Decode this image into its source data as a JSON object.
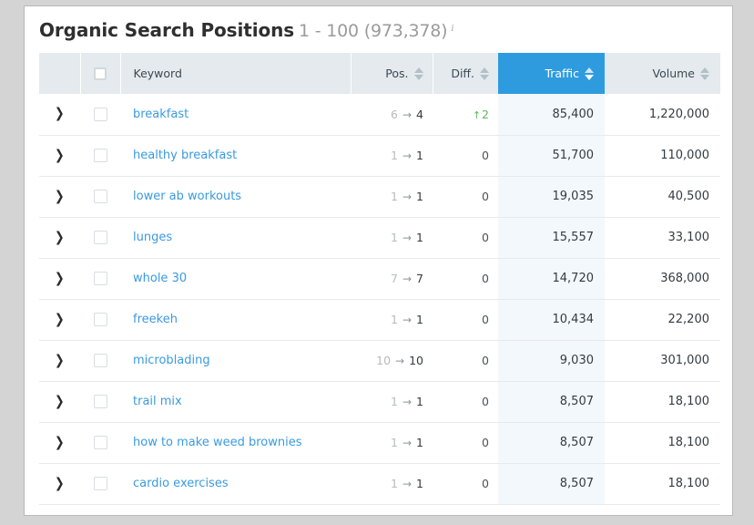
{
  "card": {
    "title": "Organic Search Positions",
    "range": "1 - 100 (973,378)",
    "info_icon": "info-icon",
    "info_glyph": "i"
  },
  "colors": {
    "accent": "#2e9bdf",
    "keyword_link": "#3a9ae0",
    "positive": "#5cb85c",
    "header_bg": "#e4eaee",
    "traffic_cell_bg": "#f3f8fc"
  },
  "table": {
    "columns": [
      {
        "key": "expand",
        "label": "",
        "sortable": false,
        "active": false
      },
      {
        "key": "select",
        "label": "",
        "sortable": false,
        "active": false
      },
      {
        "key": "keyword",
        "label": "Keyword",
        "sortable": false,
        "active": false
      },
      {
        "key": "pos",
        "label": "Pos.",
        "sortable": true,
        "active": false
      },
      {
        "key": "diff",
        "label": "Diff.",
        "sortable": true,
        "active": false
      },
      {
        "key": "traffic",
        "label": "Traffic",
        "sortable": true,
        "active": true
      },
      {
        "key": "volume",
        "label": "Volume",
        "sortable": true,
        "active": false
      }
    ],
    "select_all_checked": false,
    "rows": [
      {
        "keyword": "breakfast",
        "pos_from": "6",
        "pos_arrow": "→",
        "pos_to": "4",
        "diff": "2",
        "diff_dir": "up",
        "traffic": "85,400",
        "volume": "1,220,000",
        "checked": false
      },
      {
        "keyword": "healthy breakfast",
        "pos_from": "1",
        "pos_arrow": "→",
        "pos_to": "1",
        "diff": "0",
        "diff_dir": "none",
        "traffic": "51,700",
        "volume": "110,000",
        "checked": false
      },
      {
        "keyword": "lower ab workouts",
        "pos_from": "1",
        "pos_arrow": "→",
        "pos_to": "1",
        "diff": "0",
        "diff_dir": "none",
        "traffic": "19,035",
        "volume": "40,500",
        "checked": false
      },
      {
        "keyword": "lunges",
        "pos_from": "1",
        "pos_arrow": "→",
        "pos_to": "1",
        "diff": "0",
        "diff_dir": "none",
        "traffic": "15,557",
        "volume": "33,100",
        "checked": false
      },
      {
        "keyword": "whole 30",
        "pos_from": "7",
        "pos_arrow": "→",
        "pos_to": "7",
        "diff": "0",
        "diff_dir": "none",
        "traffic": "14,720",
        "volume": "368,000",
        "checked": false
      },
      {
        "keyword": "freekeh",
        "pos_from": "1",
        "pos_arrow": "→",
        "pos_to": "1",
        "diff": "0",
        "diff_dir": "none",
        "traffic": "10,434",
        "volume": "22,200",
        "checked": false
      },
      {
        "keyword": "microblading",
        "pos_from": "10",
        "pos_arrow": "→",
        "pos_to": "10",
        "diff": "0",
        "diff_dir": "none",
        "traffic": "9,030",
        "volume": "301,000",
        "checked": false
      },
      {
        "keyword": "trail mix",
        "pos_from": "1",
        "pos_arrow": "→",
        "pos_to": "1",
        "diff": "0",
        "diff_dir": "none",
        "traffic": "8,507",
        "volume": "18,100",
        "checked": false
      },
      {
        "keyword": "how to make weed brownies",
        "pos_from": "1",
        "pos_arrow": "→",
        "pos_to": "1",
        "diff": "0",
        "diff_dir": "none",
        "traffic": "8,507",
        "volume": "18,100",
        "checked": false
      },
      {
        "keyword": "cardio exercises",
        "pos_from": "1",
        "pos_arrow": "→",
        "pos_to": "1",
        "diff": "0",
        "diff_dir": "none",
        "traffic": "8,507",
        "volume": "18,100",
        "checked": false
      }
    ],
    "expander_glyph": "❯",
    "up_caret_glyph": "↑"
  }
}
